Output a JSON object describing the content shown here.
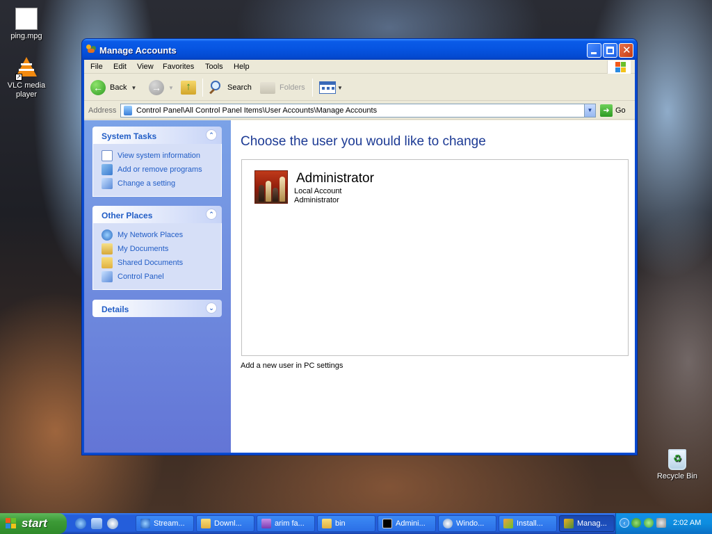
{
  "desktop": {
    "icons": [
      {
        "label": "ping.mpg",
        "icon": "video-file-icon"
      },
      {
        "label": "VLC media player",
        "icon": "vlc-icon"
      },
      {
        "label": "Recycle Bin",
        "icon": "recycle-bin-icon"
      }
    ]
  },
  "window": {
    "title": "Manage Accounts",
    "menu": [
      "File",
      "Edit",
      "View",
      "Favorites",
      "Tools",
      "Help"
    ],
    "toolbar": {
      "back": "Back",
      "search": "Search",
      "folders": "Folders"
    },
    "address": {
      "label": "Address",
      "value": "Control Panel\\All Control Panel Items\\User Accounts\\Manage Accounts",
      "go": "Go"
    }
  },
  "sidebar": {
    "system_tasks": {
      "title": "System Tasks",
      "items": [
        "View system information",
        "Add or remove programs",
        "Change a setting"
      ]
    },
    "other_places": {
      "title": "Other Places",
      "items": [
        "My Network Places",
        "My Documents",
        "Shared Documents",
        "Control Panel"
      ]
    },
    "details": {
      "title": "Details"
    }
  },
  "main": {
    "heading": "Choose the user you would like to change",
    "account": {
      "name": "Administrator",
      "type": "Local Account",
      "group": "Administrator"
    },
    "add_user_link": "Add a new user in PC settings"
  },
  "taskbar": {
    "start": "start",
    "buttons": [
      "Stream...",
      "Downl...",
      "arim fa...",
      "bin",
      "Admini...",
      "Windo...",
      "Install...",
      "Manag..."
    ],
    "active_index": 7,
    "clock": "2:02 AM"
  },
  "colors": {
    "title_bar": "#0654e0",
    "sidebar_link": "#215dc6",
    "heading": "#1c3a94",
    "taskbar": "#245edb",
    "start_button": "#3c9a36"
  }
}
